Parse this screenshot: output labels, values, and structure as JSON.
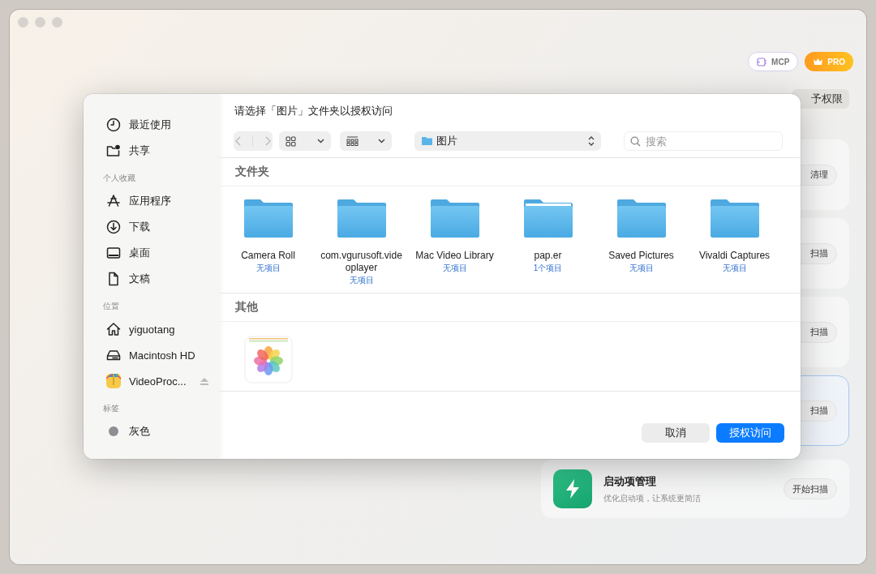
{
  "header_buttons": [
    {
      "label": "MCP",
      "kind": "mcp"
    },
    {
      "label": "PRO",
      "kind": "pro"
    }
  ],
  "background": {
    "permission_button": "予权限",
    "cards": [
      {
        "button": "清理",
        "highlighted": false
      },
      {
        "button": "扫描",
        "highlighted": false
      },
      {
        "button": "扫描",
        "highlighted": false
      },
      {
        "button": "扫描",
        "highlighted": true
      },
      {
        "kind": "full",
        "title": "启动项管理",
        "subtitle": "优化启动项，让系统更简洁",
        "button": "开始扫描",
        "highlighted": false
      }
    ]
  },
  "dialog": {
    "title": "请选择「图片」文件夹以授权访问",
    "sidebar": [
      {
        "items": [
          {
            "label": "最近使用",
            "kind": "recent"
          },
          {
            "label": "共享",
            "kind": "shared"
          }
        ]
      },
      {
        "heading": "个人收藏",
        "items": [
          {
            "label": "应用程序",
            "kind": "apps"
          },
          {
            "label": "下载",
            "kind": "download"
          },
          {
            "label": "桌面",
            "kind": "desktop"
          },
          {
            "label": "文稿",
            "kind": "document"
          }
        ]
      },
      {
        "heading": "位置",
        "items": [
          {
            "label": "yiguotang",
            "kind": "home"
          },
          {
            "label": "Macintosh HD",
            "kind": "disk"
          },
          {
            "label": "VideoProc...",
            "kind": "volume"
          }
        ]
      },
      {
        "heading": "标签",
        "items": [
          {
            "label": "灰色",
            "kind": "tag",
            "color": "#8e8e93"
          }
        ]
      }
    ],
    "location": "图片",
    "search_placeholder": "搜索",
    "sections": [
      {
        "heading": "文件夹",
        "items": [
          {
            "kind": "folder",
            "name": "Camera Roll",
            "count": "无项目"
          },
          {
            "kind": "folder",
            "name": "com.vgurusoft.videoplayer",
            "count": "无项目"
          },
          {
            "kind": "folder",
            "name": "Mac Video Library",
            "count": "无项目"
          },
          {
            "kind": "folder",
            "name": "pap.er",
            "count": "1个项目"
          },
          {
            "kind": "folder",
            "name": "Saved Pictures",
            "count": "无项目"
          },
          {
            "kind": "folder",
            "name": "Vivaldi Captures",
            "count": "无项目"
          }
        ]
      },
      {
        "heading": "其他",
        "items": [
          {
            "kind": "photos-app"
          }
        ]
      }
    ],
    "buttons": [
      {
        "label": "取消",
        "kind": "secondary"
      },
      {
        "label": "授权访问",
        "kind": "primary"
      }
    ]
  }
}
